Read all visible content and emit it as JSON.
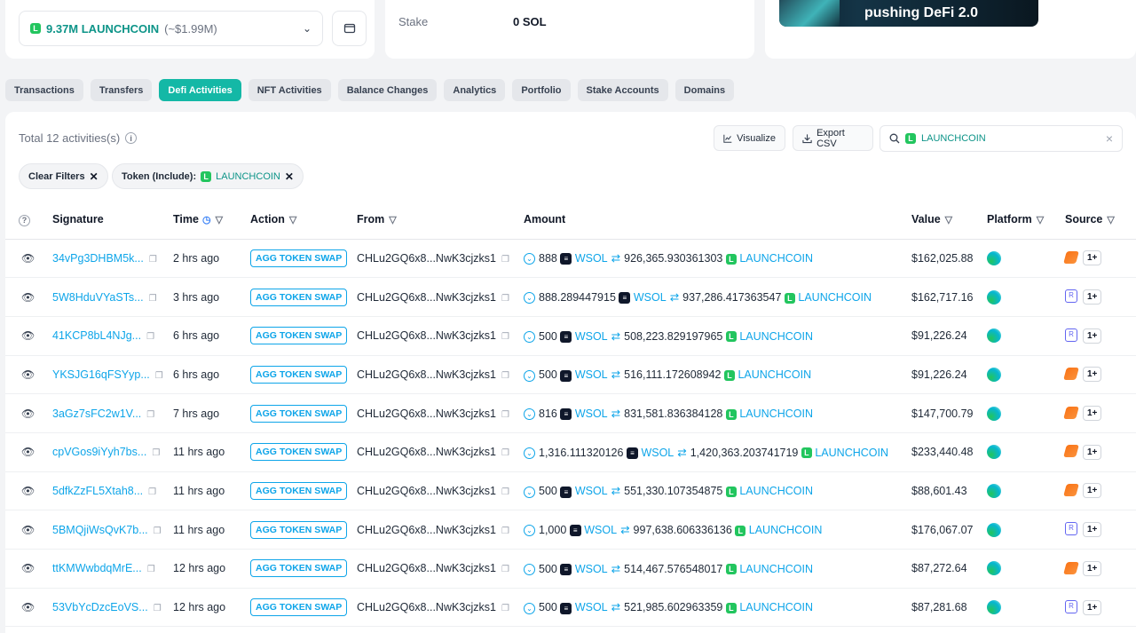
{
  "balance": {
    "amount": "9.37M LAUNCHCOIN",
    "usd": "(~$1.99M)"
  },
  "stake": {
    "label": "Stake",
    "value": "0 SOL"
  },
  "banner": {
    "text": "pushing DeFi 2.0"
  },
  "tabs": [
    "Transactions",
    "Transfers",
    "Defi Activities",
    "NFT Activities",
    "Balance Changes",
    "Analytics",
    "Portfolio",
    "Stake Accounts",
    "Domains"
  ],
  "active_tab": "Defi Activities",
  "toolbar": {
    "total": "Total 12 activities(s)",
    "visualize": "Visualize",
    "export": "Export CSV",
    "search_value": "LAUNCHCOIN"
  },
  "filters": {
    "clear": "Clear Filters",
    "token_label": "Token (Include):",
    "token_value": "LAUNCHCOIN"
  },
  "columns": [
    "Signature",
    "Time",
    "Action",
    "From",
    "Amount",
    "Value",
    "Platform",
    "Source"
  ],
  "rows": [
    {
      "sig": "34vPg3DHBM5k...",
      "time": "2 hrs ago",
      "action": "AGG TOKEN SWAP",
      "from": "CHLu2GQ6x8...NwK3cjzks1",
      "in_amt": "888",
      "in_tok": "WSOL",
      "out_amt": "926,365.930361303",
      "out_tok": "LAUNCHCOIN",
      "value": "$162,025.88",
      "source": "jupiter",
      "more": "1+"
    },
    {
      "sig": "5W8HduVYaSTs...",
      "time": "3 hrs ago",
      "action": "AGG TOKEN SWAP",
      "from": "CHLu2GQ6x8...NwK3cjzks1",
      "in_amt": "888.289447915",
      "in_tok": "WSOL",
      "out_amt": "937,286.417363547",
      "out_tok": "LAUNCHCOIN",
      "value": "$162,717.16",
      "source": "raydium",
      "more": "1+"
    },
    {
      "sig": "41KCP8bL4NJg...",
      "time": "6 hrs ago",
      "action": "AGG TOKEN SWAP",
      "from": "CHLu2GQ6x8...NwK3cjzks1",
      "in_amt": "500",
      "in_tok": "WSOL",
      "out_amt": "508,223.829197965",
      "out_tok": "LAUNCHCOIN",
      "value": "$91,226.24",
      "source": "raydium",
      "more": "1+"
    },
    {
      "sig": "YKSJG16qFSYyp...",
      "time": "6 hrs ago",
      "action": "AGG TOKEN SWAP",
      "from": "CHLu2GQ6x8...NwK3cjzks1",
      "in_amt": "500",
      "in_tok": "WSOL",
      "out_amt": "516,111.172608942",
      "out_tok": "LAUNCHCOIN",
      "value": "$91,226.24",
      "source": "jupiter",
      "more": "1+"
    },
    {
      "sig": "3aGz7sFC2w1V...",
      "time": "7 hrs ago",
      "action": "AGG TOKEN SWAP",
      "from": "CHLu2GQ6x8...NwK3cjzks1",
      "in_amt": "816",
      "in_tok": "WSOL",
      "out_amt": "831,581.836384128",
      "out_tok": "LAUNCHCOIN",
      "value": "$147,700.79",
      "source": "jupiter",
      "more": "1+"
    },
    {
      "sig": "cpVGos9iYyh7bs...",
      "time": "11 hrs ago",
      "action": "AGG TOKEN SWAP",
      "from": "CHLu2GQ6x8...NwK3cjzks1",
      "in_amt": "1,316.111320126",
      "in_tok": "WSOL",
      "out_amt": "1,420,363.203741719",
      "out_tok": "LAUNCHCOIN",
      "value": "$233,440.48",
      "source": "jupiter",
      "more": "1+"
    },
    {
      "sig": "5dfkZzFL5Xtah8...",
      "time": "11 hrs ago",
      "action": "AGG TOKEN SWAP",
      "from": "CHLu2GQ6x8...NwK3cjzks1",
      "in_amt": "500",
      "in_tok": "WSOL",
      "out_amt": "551,330.107354875",
      "out_tok": "LAUNCHCOIN",
      "value": "$88,601.43",
      "source": "jupiter",
      "more": "1+"
    },
    {
      "sig": "5BMQjiWsQvK7b...",
      "time": "11 hrs ago",
      "action": "AGG TOKEN SWAP",
      "from": "CHLu2GQ6x8...NwK3cjzks1",
      "in_amt": "1,000",
      "in_tok": "WSOL",
      "out_amt": "997,638.606336136",
      "out_tok": "LAUNCHCOIN",
      "value": "$176,067.07",
      "source": "raydium",
      "more": "1+"
    },
    {
      "sig": "ttKMWwbdqMrE...",
      "time": "12 hrs ago",
      "action": "AGG TOKEN SWAP",
      "from": "CHLu2GQ6x8...NwK3cjzks1",
      "in_amt": "500",
      "in_tok": "WSOL",
      "out_amt": "514,467.576548017",
      "out_tok": "LAUNCHCOIN",
      "value": "$87,272.64",
      "source": "jupiter",
      "more": "1+"
    },
    {
      "sig": "53VbYcDzcEoVS...",
      "time": "12 hrs ago",
      "action": "AGG TOKEN SWAP",
      "from": "CHLu2GQ6x8...NwK3cjzks1",
      "in_amt": "500",
      "in_tok": "WSOL",
      "out_amt": "521,985.602963359",
      "out_tok": "LAUNCHCOIN",
      "value": "$87,281.68",
      "source": "raydium",
      "more": "1+"
    }
  ]
}
